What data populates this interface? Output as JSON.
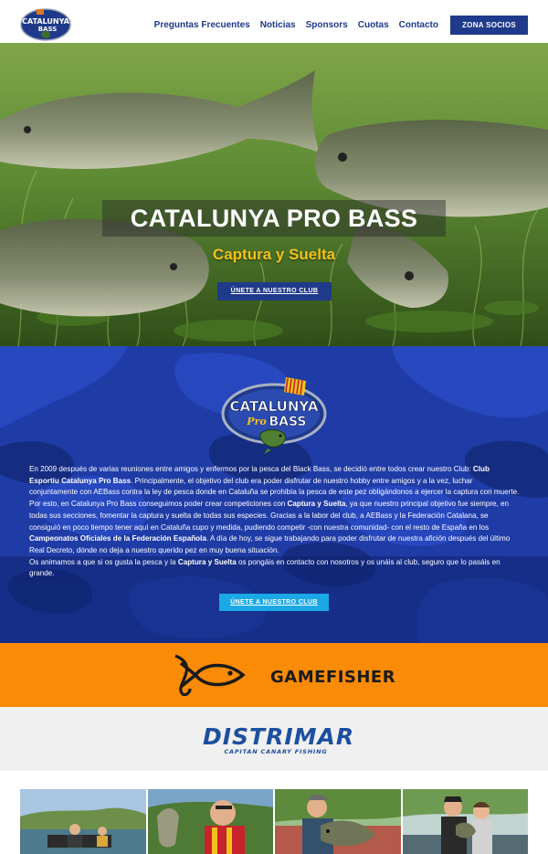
{
  "header": {
    "logo_alt": "Catalunya Pro Bass",
    "nav": [
      {
        "label": "Preguntas Frecuentes"
      },
      {
        "label": "Noticias"
      },
      {
        "label": "Sponsors"
      },
      {
        "label": "Cuotas"
      },
      {
        "label": "Contacto"
      }
    ],
    "zona_socios": "ZONA SOCIOS"
  },
  "hero": {
    "title": "CATALUNYA PRO BASS",
    "subtitle": "Captura y Suelta",
    "button": "ÚNETE A NUESTRO CLUB"
  },
  "club": {
    "paragraph1": [
      {
        "t": "En 2009 después de varias reuniones entre amigos y enfermos por la pesca del Black Bass, se decidió entre todos crear nuestro Club: ",
        "b": false
      },
      {
        "t": "Club Esportiu Catalunya Pro Bass",
        "b": true
      },
      {
        "t": ". Principalmente, el objetivo del club era poder disfrutar de nuestro hobby entre amigos y a la vez, luchar conjuntamente con AEBass contra la ley de pesca donde en Cataluña se prohibía la pesca de este pez obligándonos a ejercer la captura con muerte. Por esto, en Catalunya Pro Bass conseguimos poder crear competiciones con ",
        "b": false
      },
      {
        "t": "Captura y Suelta",
        "b": true
      },
      {
        "t": ", ya que nuestro principal objetivo fue siempre, en todas sus secciones, fomentar la captura y suelta de todas sus especies. Gracias a la labor del club, a AEBass y la Federación Catalana, se consiguió en poco tiempo tener aquí en Cataluña cupo y medida, pudiendo competir -con nuestra comunidad- con el resto de España en los ",
        "b": false
      },
      {
        "t": "Campeonatos Oficiales de la Federación Española",
        "b": true
      },
      {
        "t": ". A día de hoy, se sigue trabajando para poder disfrutar de nuestra afición después del último Real Decreto, dónde no deja a nuestro querido pez en muy buena situación.",
        "b": false
      }
    ],
    "paragraph2": [
      {
        "t": "Os animamos a que si os gusta la pesca y la ",
        "b": false
      },
      {
        "t": "Captura y Suelta",
        "b": true
      },
      {
        "t": " os pongáis en contacto con nosotros y os unáis al club, seguro que lo pasáis en grande.",
        "b": false
      }
    ],
    "button": "ÚNETE A NUESTRO CLUB"
  },
  "sponsors": {
    "gamefisher": "GAMEFISHER",
    "distrimar": "DISTRIMAR",
    "distrimar_sub": "CAPITAN CANARY FISHING"
  },
  "colors": {
    "brand_blue": "#1f3a8a",
    "gold": "#f2c21a",
    "light_blue_button": "#1ba8e6",
    "gamefisher_orange": "#f98b07"
  },
  "icons": [
    "catalunya-pro-bass-logo",
    "gamefisher-fish-hook-icon",
    "distrimar-logo"
  ]
}
